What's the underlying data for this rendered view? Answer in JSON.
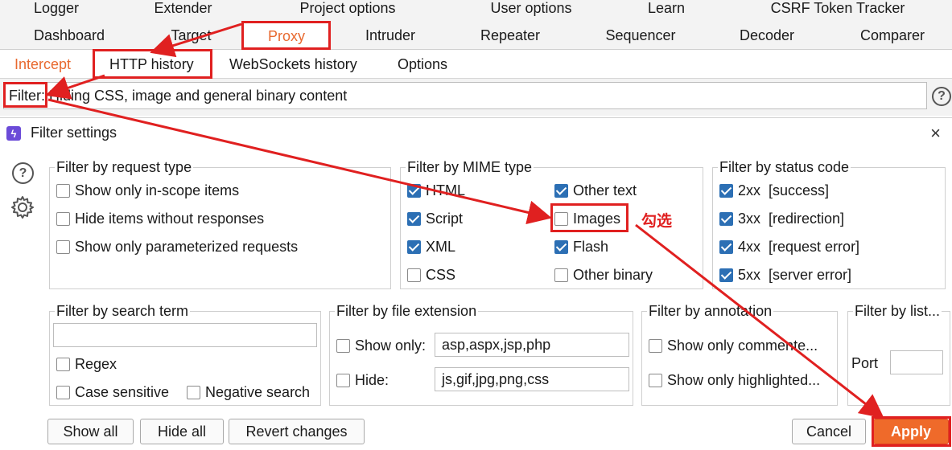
{
  "tabs": {
    "row1": [
      "Logger",
      "Extender",
      "Project options",
      "User options",
      "Learn",
      "CSRF Token Tracker"
    ],
    "row2": [
      "Dashboard",
      "Target",
      "Proxy",
      "Intruder",
      "Repeater",
      "Sequencer",
      "Decoder",
      "Comparer"
    ]
  },
  "subtabs": [
    "Intercept",
    "HTTP history",
    "WebSockets history",
    "Options"
  ],
  "filter_bar": {
    "text": "Filter: Hiding CSS, image and general binary content",
    "help": "?"
  },
  "dialog": {
    "title": "Filter settings",
    "close": "×"
  },
  "request_type": {
    "title": "Filter by request type",
    "items": [
      {
        "label": "Show only in-scope items",
        "checked": false
      },
      {
        "label": "Hide items without responses",
        "checked": false
      },
      {
        "label": "Show only parameterized requests",
        "checked": false
      }
    ]
  },
  "mime": {
    "title": "Filter by MIME type",
    "items": [
      {
        "label": "HTML",
        "checked": true
      },
      {
        "label": "Other text",
        "checked": true
      },
      {
        "label": "Script",
        "checked": true
      },
      {
        "label": "Images",
        "checked": false
      },
      {
        "label": "XML",
        "checked": true
      },
      {
        "label": "Flash",
        "checked": true
      },
      {
        "label": "CSS",
        "checked": false
      },
      {
        "label": "Other binary",
        "checked": false
      }
    ]
  },
  "status": {
    "title": "Filter by status code",
    "items": [
      {
        "label": "2xx  [success]",
        "checked": true
      },
      {
        "label": "3xx  [redirection]",
        "checked": true
      },
      {
        "label": "4xx  [request error]",
        "checked": true
      },
      {
        "label": "5xx  [server error]",
        "checked": true
      }
    ]
  },
  "search": {
    "title": "Filter by search term",
    "value": "",
    "regex": "Regex",
    "case_sensitive": "Case sensitive",
    "negative": "Negative search"
  },
  "extension": {
    "title": "Filter by file extension",
    "show_only_label": "Show only:",
    "show_only_value": "asp,aspx,jsp,php",
    "hide_label": "Hide:",
    "hide_value": "js,gif,jpg,png,css"
  },
  "annotation": {
    "title": "Filter by annotation",
    "commented": "Show only commente...",
    "highlighted": "Show only highlighted..."
  },
  "listener": {
    "title": "Filter by list...",
    "port_label": "Port",
    "port_value": ""
  },
  "buttons": {
    "show_all": "Show all",
    "hide_all": "Hide all",
    "revert": "Revert changes",
    "cancel": "Cancel",
    "apply": "Apply"
  },
  "annotation_text": "勾选",
  "colors": {
    "accent": "#e8692f",
    "check": "#2c6fb4",
    "annotation": "#e02020"
  }
}
